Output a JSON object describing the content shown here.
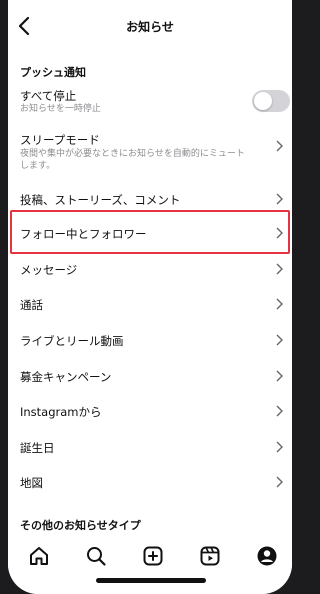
{
  "header": {
    "title": "お知らせ"
  },
  "push_section": {
    "title": "プッシュ通知"
  },
  "pause_all": {
    "label": "すべて停止",
    "subtitle": "お知らせを一時停止",
    "enabled": false
  },
  "sleep_mode": {
    "label": "スリープモード",
    "subtitle_line1": "夜間や集中が必要なときにお知らせを自動的にミュート",
    "subtitle_line2": "します。"
  },
  "items": [
    {
      "label": "投稿、ストーリーズ、コメント"
    },
    {
      "label": "フォロー中とフォロワー"
    },
    {
      "label": "メッセージ"
    },
    {
      "label": "通話"
    },
    {
      "label": "ライブとリール動画"
    },
    {
      "label": "募金キャンペーン"
    },
    {
      "label": "Instagramから"
    },
    {
      "label": "誕生日"
    },
    {
      "label": "地図"
    }
  ],
  "other_section": {
    "title": "その他のお知らせタイプ"
  },
  "tabbar": {
    "tabs": [
      {
        "icon": "home-icon"
      },
      {
        "icon": "search-icon"
      },
      {
        "icon": "create-icon"
      },
      {
        "icon": "reels-icon"
      },
      {
        "icon": "profile-icon"
      }
    ]
  },
  "colors": {
    "highlight": "#e3343f",
    "toggle_off": "#d4d4d8"
  }
}
